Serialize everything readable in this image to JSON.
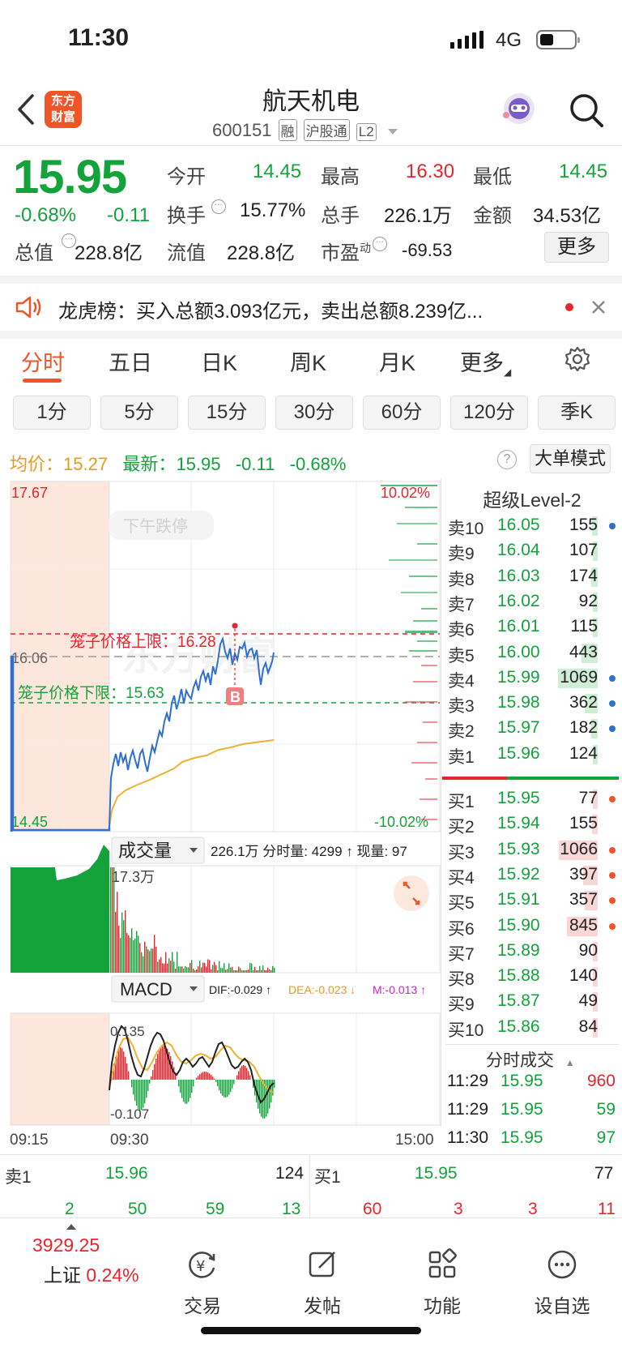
{
  "status": {
    "time": "11:30",
    "network": "4G"
  },
  "header": {
    "logo_line1": "东方",
    "logo_line2": "财富",
    "name": "航天机电",
    "code": "600151",
    "tags": [
      "融",
      "沪股通",
      "L2"
    ]
  },
  "quote": {
    "price": "15.95",
    "change_pct": "-0.68%",
    "change": "-0.11",
    "open_label": "今开",
    "open": "14.45",
    "high_label": "最高",
    "high": "16.30",
    "low_label": "最低",
    "low": "14.45",
    "turnover_label": "换手",
    "turnover": "15.77%",
    "volume_label": "总手",
    "volume": "226.1万",
    "amount_label": "金额",
    "amount": "34.53亿",
    "mktcap_label": "总值",
    "mktcap": "228.8亿",
    "float_label": "流值",
    "float": "228.8亿",
    "pe_label": "市盈",
    "pe_sup": "动",
    "pe": "-69.53",
    "more": "更多"
  },
  "notice": {
    "text": "龙虎榜：买入总额3.093亿元，卖出总额8.239亿..."
  },
  "tabs": [
    "分时",
    "五日",
    "日K",
    "周K",
    "月K",
    "更多"
  ],
  "periods": [
    "1分",
    "5分",
    "15分",
    "30分",
    "60分",
    "120分",
    "季K"
  ],
  "info": {
    "avg_label": "均价：",
    "avg": "15.27",
    "latest_label": "最新：",
    "latest": "15.95",
    "chg": "-0.11",
    "pct": "-0.68%",
    "mode": "大单模式"
  },
  "intraday": {
    "y_top": "17.67",
    "y_mid": "16.06",
    "y_bot": "14.45",
    "pct_top": "10.02%",
    "pct_bot": "-10.02%",
    "watermark_halt": "下午跌停",
    "cage_upper": "笼子价格上限：16.28",
    "cage_lower": "笼子价格下限：15.63",
    "marker": "B"
  },
  "volume_panel": {
    "selector": "成交量",
    "summary": "226.1万 分时量: 4299 ↑ 现量: 97",
    "max": "17.3万"
  },
  "macd_panel": {
    "selector": "MACD",
    "dif": "DIF:-0.029 ↑",
    "dea": "DEA:-0.023 ↓",
    "m": "M:-0.013 ↑",
    "max": "0.135",
    "min": "-0.107"
  },
  "time_axis": [
    "09:15",
    "09:30",
    "15:00"
  ],
  "orderbook": {
    "title": "超级Level-2",
    "asks": [
      {
        "label": "卖10",
        "price": "16.05",
        "vol": "155"
      },
      {
        "label": "卖9",
        "price": "16.04",
        "vol": "107"
      },
      {
        "label": "卖8",
        "price": "16.03",
        "vol": "174"
      },
      {
        "label": "卖7",
        "price": "16.02",
        "vol": "92"
      },
      {
        "label": "卖6",
        "price": "16.01",
        "vol": "115"
      },
      {
        "label": "卖5",
        "price": "16.00",
        "vol": "443"
      },
      {
        "label": "卖4",
        "price": "15.99",
        "vol": "1069"
      },
      {
        "label": "卖3",
        "price": "15.98",
        "vol": "362"
      },
      {
        "label": "卖2",
        "price": "15.97",
        "vol": "182"
      },
      {
        "label": "卖1",
        "price": "15.96",
        "vol": "124"
      }
    ],
    "bids": [
      {
        "label": "买1",
        "price": "15.95",
        "vol": "77"
      },
      {
        "label": "买2",
        "price": "15.94",
        "vol": "155"
      },
      {
        "label": "买3",
        "price": "15.93",
        "vol": "1066"
      },
      {
        "label": "买4",
        "price": "15.92",
        "vol": "397"
      },
      {
        "label": "买5",
        "price": "15.91",
        "vol": "357"
      },
      {
        "label": "买6",
        "price": "15.90",
        "vol": "845"
      },
      {
        "label": "买7",
        "price": "15.89",
        "vol": "90"
      },
      {
        "label": "买8",
        "price": "15.88",
        "vol": "140"
      },
      {
        "label": "买9",
        "price": "15.87",
        "vol": "49"
      },
      {
        "label": "买10",
        "price": "15.86",
        "vol": "84"
      }
    ],
    "trades_title": "分时成交",
    "trades": [
      {
        "time": "11:29",
        "price": "15.95",
        "vol": "960"
      },
      {
        "time": "11:29",
        "price": "15.95",
        "vol": "59"
      },
      {
        "time": "11:30",
        "price": "15.95",
        "vol": "97"
      }
    ]
  },
  "bottom": {
    "sell1_label": "卖1",
    "sell1_price": "15.96",
    "sell1_vol": "124",
    "buy1_label": "买1",
    "buy1_price": "15.95",
    "buy1_vol": "77",
    "sell_queue": [
      "2",
      "50",
      "59",
      "13"
    ],
    "buy_queue": [
      "60",
      "3",
      "3",
      "11"
    ]
  },
  "nav": {
    "index_value": "3929.25",
    "index_name": "上证",
    "index_pct": "0.24%",
    "items": [
      "交易",
      "发帖",
      "功能",
      "设自选"
    ]
  },
  "colors": {
    "up": "#e8242c",
    "down": "#13a33a",
    "brand": "#f0552a",
    "price_line": "#2f6fd0",
    "avg_line": "#f0b030"
  }
}
